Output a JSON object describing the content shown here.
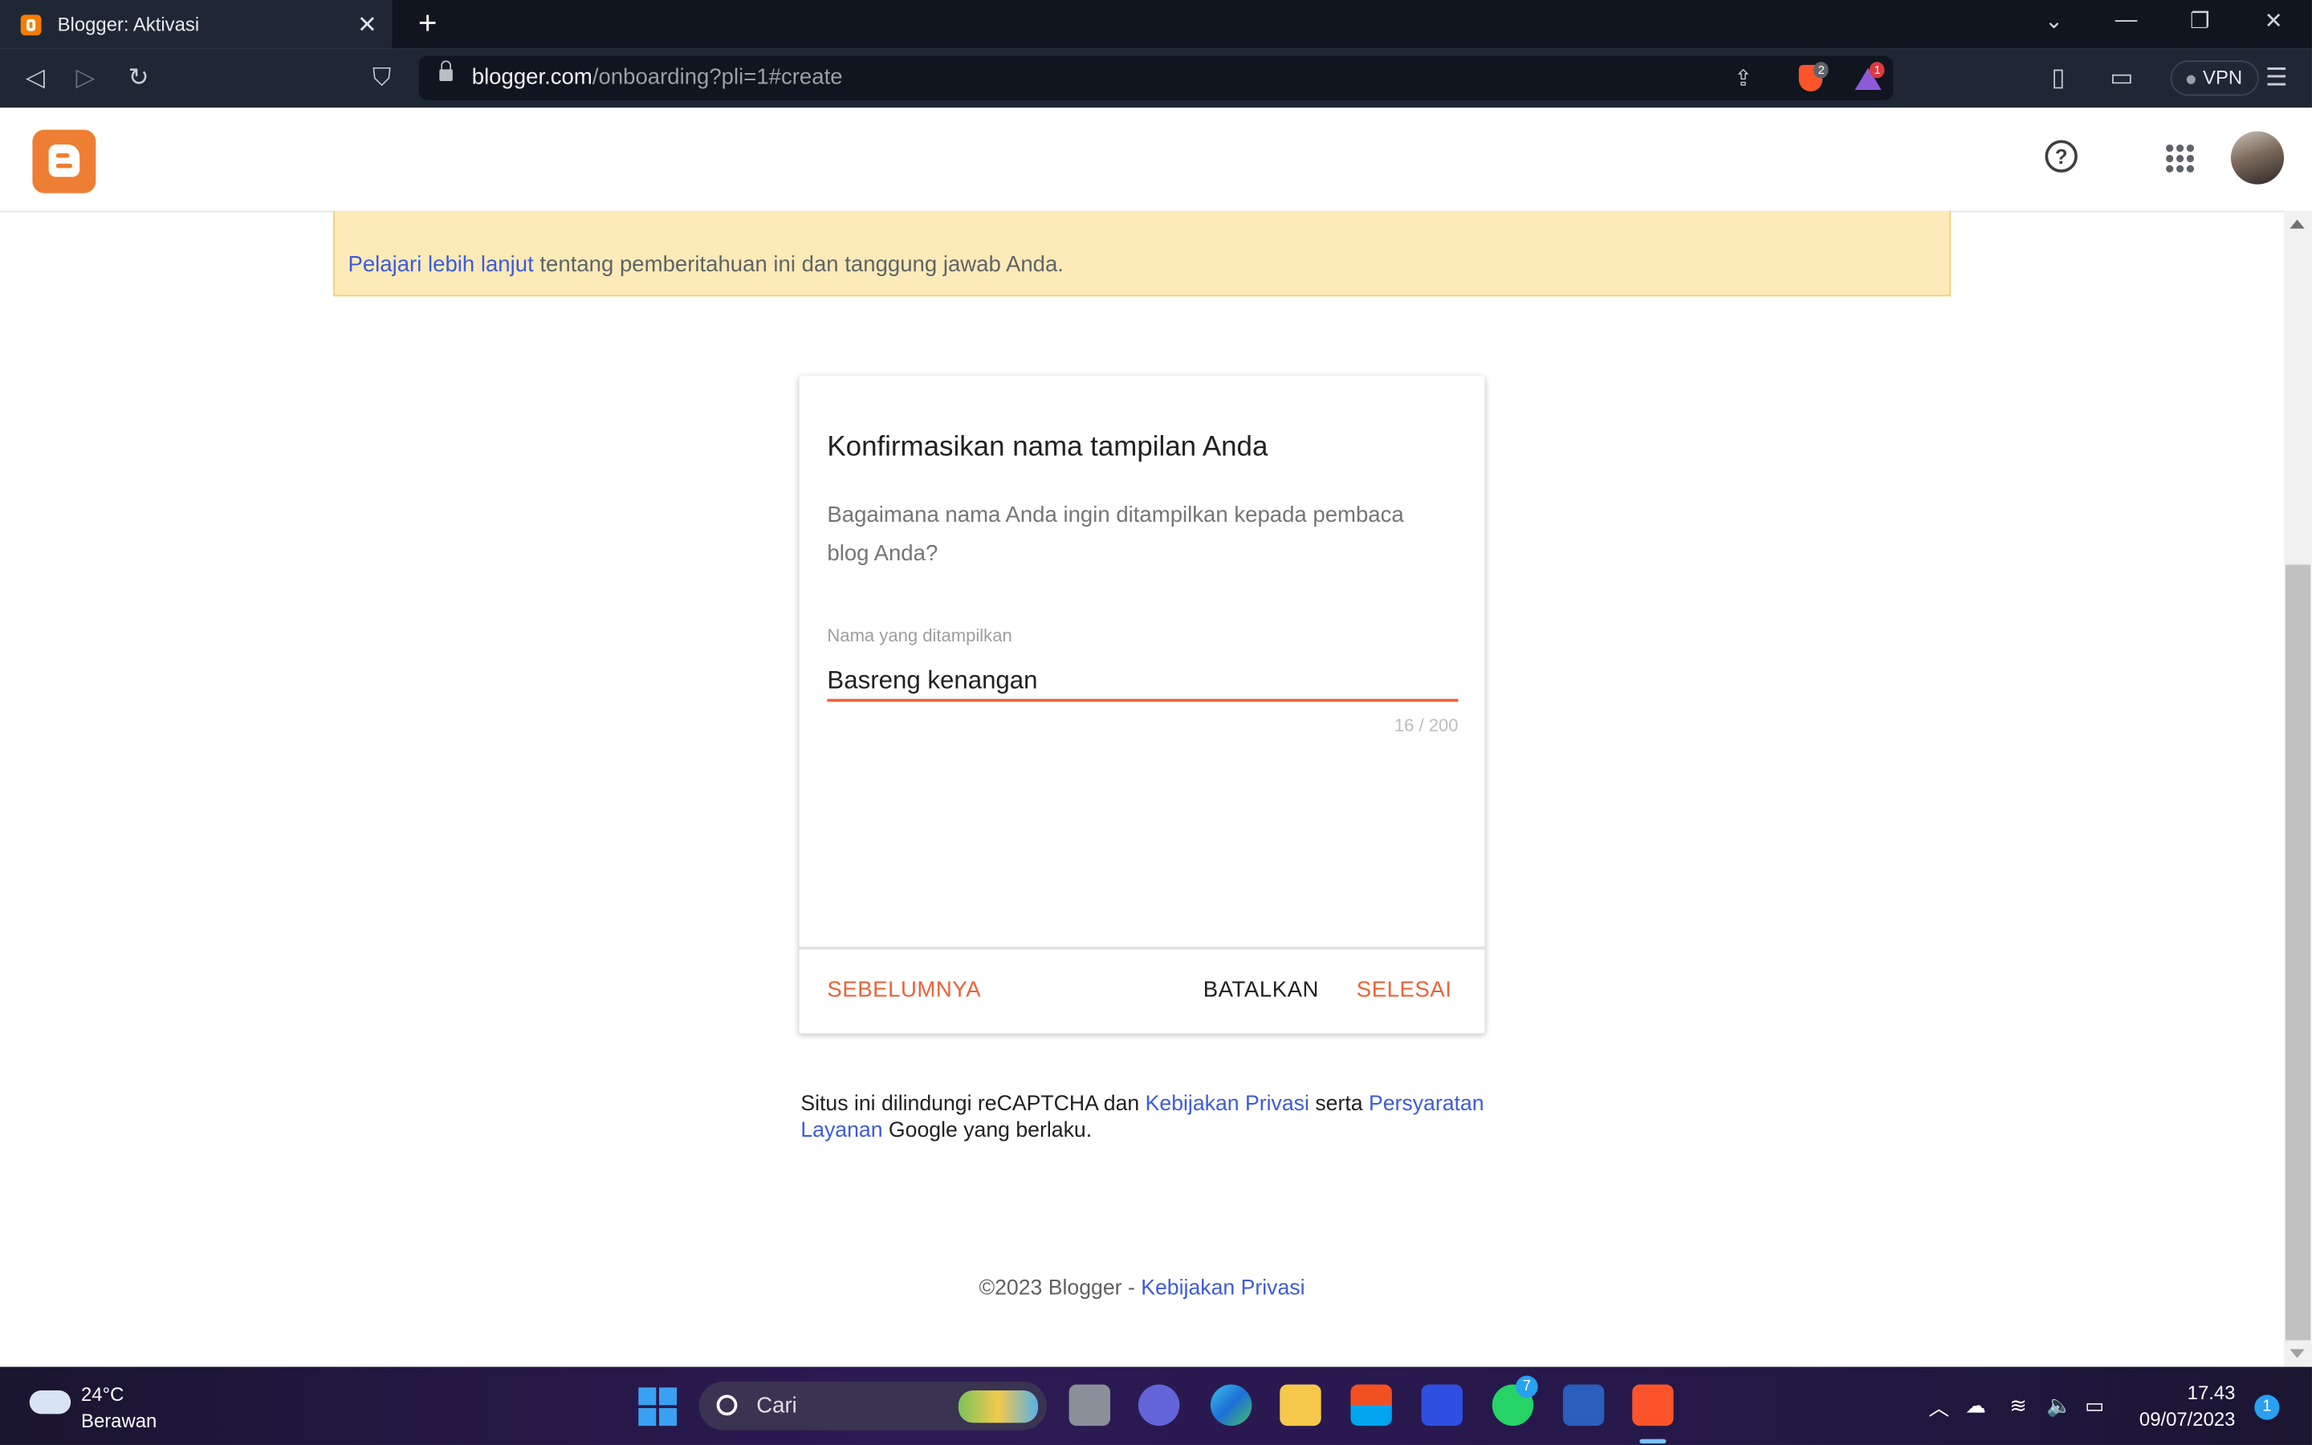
{
  "browser": {
    "tab_title": "Blogger: Aktivasi",
    "tab_close": "✕",
    "new_tab": "+",
    "url_host": "blogger.com",
    "url_path": "/onboarding?pli=1#create",
    "shields_count": "2",
    "rewards_count": "1",
    "vpn_label": "VPN",
    "window_controls": [
      "⌄",
      "—",
      "❐",
      "✕"
    ]
  },
  "header": {
    "logo": "blogger-logo",
    "help_icon": "?"
  },
  "notice": {
    "link_text": "Pelajari lebih lanjut",
    "text": " tentang pemberitahuan ini dan tanggung jawab Anda."
  },
  "dialog": {
    "title": "Konfirmasikan nama tampilan Anda",
    "description": "Bagaimana nama Anda ingin ditampilkan kepada pembaca blog Anda?",
    "field_label": "Nama yang ditampilkan",
    "field_value": "Basreng kenangan",
    "counter": "16 / 200",
    "prev_label": "SEBELUMNYA",
    "cancel_label": "BATALKAN",
    "done_label": "SELESAI"
  },
  "captcha": {
    "text1": "Situs ini dilindungi reCAPTCHA dan ",
    "privacy_link": "Kebijakan Privasi",
    "text2": " serta ",
    "terms_link": "Persyaratan Layanan",
    "text3": " Google yang berlaku."
  },
  "footer": {
    "copyright": "©2023 Blogger - ",
    "privacy_link": "Kebijakan Privasi"
  },
  "taskbar": {
    "weather_temp": "24°C",
    "weather_desc": "Berawan",
    "search_placeholder": "Cari",
    "whatsapp_badge": "7",
    "time": "17.43",
    "date": "09/07/2023",
    "notification_count": "1"
  },
  "colors": {
    "accent": "#e8643a",
    "link": "#3d5bdc",
    "notice_bg": "#fcebb8",
    "blogger_orange": "#ee7e33"
  }
}
